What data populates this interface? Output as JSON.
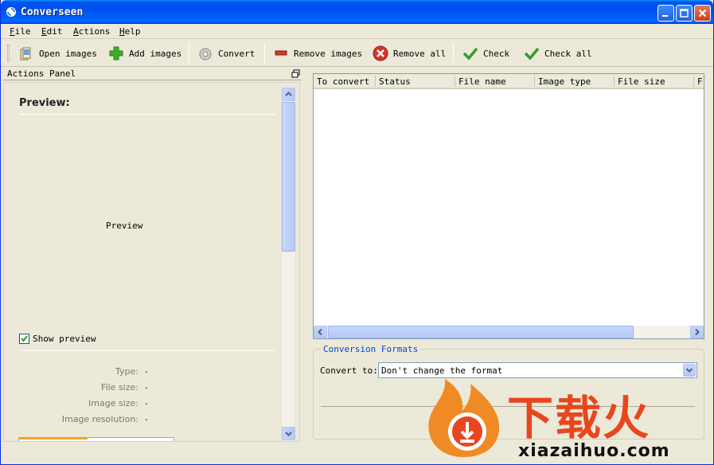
{
  "window": {
    "title": "Converseen"
  },
  "menu": {
    "items": [
      "File",
      "Edit",
      "Actions",
      "Help"
    ]
  },
  "toolbar": {
    "open_images": "Open images",
    "add_images": "Add images",
    "convert": "Convert",
    "remove_images": "Remove images",
    "remove_all": "Remove all",
    "check": "Check",
    "check_all": "Check all"
  },
  "actions_panel": {
    "title": "Actions Panel",
    "preview_title": "Preview:",
    "preview_placeholder": "Preview",
    "show_preview_label": "Show preview",
    "show_preview_checked": true,
    "info": [
      {
        "key": "Type:",
        "value": "-"
      },
      {
        "key": "File size:",
        "value": "-"
      },
      {
        "key": "Image size:",
        "value": "-"
      },
      {
        "key": "Image resolution:",
        "value": "-"
      }
    ]
  },
  "file_table": {
    "columns": [
      "To convert",
      "Status",
      "File name",
      "Image type",
      "File size",
      "F"
    ]
  },
  "conversion": {
    "group_title": "Conversion Formats",
    "convert_to_label": "Convert to:",
    "selected_format": "Don't change the format"
  },
  "watermark": {
    "brand_cn": "下载火",
    "url": "xiazaihuo.com"
  },
  "colors": {
    "title_bar": "#0054e3",
    "group_title": "#0046d5",
    "watermark_orange": "#e8461e"
  }
}
